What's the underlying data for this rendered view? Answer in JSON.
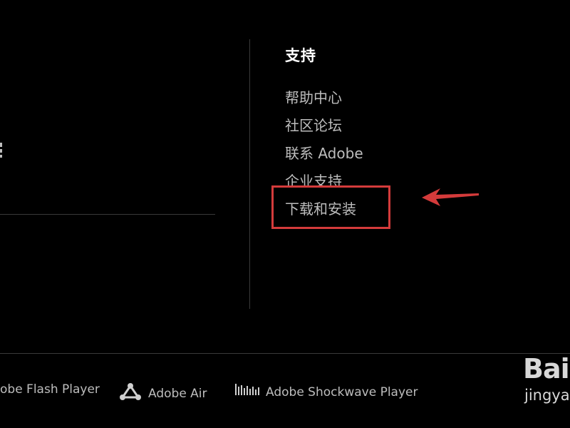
{
  "support": {
    "title": "支持",
    "links": [
      {
        "label": "帮助中心"
      },
      {
        "label": "社区论坛"
      },
      {
        "label": "联系 Adobe"
      },
      {
        "label": "企业支持"
      },
      {
        "label": "下载和安装"
      }
    ]
  },
  "players": [
    {
      "label": "obe Flash Player",
      "icon": "flash-icon"
    },
    {
      "label": "Adobe Air",
      "icon": "air-icon"
    },
    {
      "label": "Adobe Shockwave Player",
      "icon": "shockwave-icon"
    }
  ],
  "annotation": {
    "color": "#d43b3b"
  },
  "watermark": {
    "logo": "Bai",
    "sub": "jingya"
  }
}
